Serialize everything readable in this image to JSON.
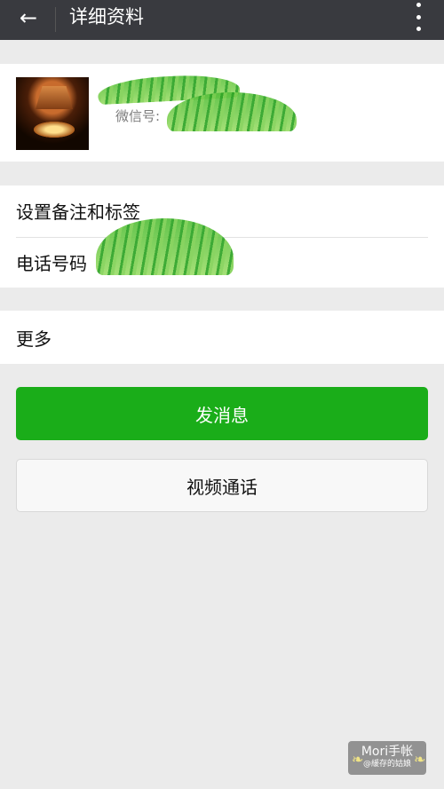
{
  "topbar": {
    "title": "详细资料",
    "back_icon": "arrow-left-icon",
    "menu_icon": "more-vertical-icon"
  },
  "profile": {
    "avatar_icon": "profile-avatar",
    "wechat_id_label": "微信号:"
  },
  "settings": {
    "remark_tags_label": "设置备注和标签",
    "phone_label": "电话号码"
  },
  "more": {
    "label": "更多"
  },
  "actions": {
    "send_message_label": "发消息",
    "video_call_label": "视频通话"
  },
  "watermark": {
    "line1": "Mori手帐",
    "line2": "@緩存的姑娘"
  },
  "colors": {
    "topbar": "#393a3f",
    "primary_button": "#1aad19",
    "secondary_button": "#f8f8f8",
    "background": "#ebebeb"
  }
}
